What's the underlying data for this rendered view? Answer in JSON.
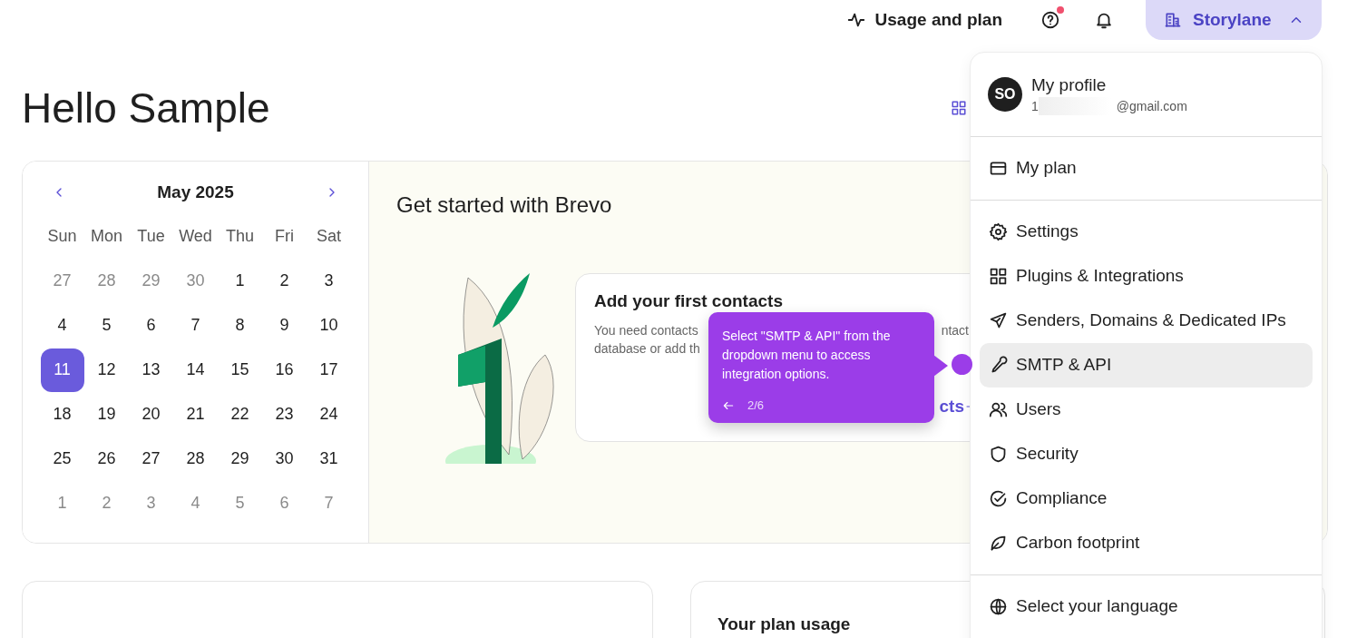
{
  "header": {
    "usage_link": "Usage and plan",
    "help_has_notification": true,
    "account_button": {
      "label": "Storylane",
      "expanded": true
    }
  },
  "greeting": "Hello Sample",
  "calendar": {
    "month": "May 2025",
    "weekdays": [
      "Sun",
      "Mon",
      "Tue",
      "Wed",
      "Thu",
      "Fri",
      "Sat"
    ],
    "weeks": [
      [
        {
          "day": "27",
          "outside": true,
          "selected": false
        },
        {
          "day": "28",
          "outside": true,
          "selected": false
        },
        {
          "day": "29",
          "outside": true,
          "selected": false
        },
        {
          "day": "30",
          "outside": true,
          "selected": false
        },
        {
          "day": "1",
          "outside": false,
          "selected": false
        },
        {
          "day": "2",
          "outside": false,
          "selected": false
        },
        {
          "day": "3",
          "outside": false,
          "selected": false
        }
      ],
      [
        {
          "day": "4",
          "outside": false,
          "selected": false
        },
        {
          "day": "5",
          "outside": false,
          "selected": false
        },
        {
          "day": "6",
          "outside": false,
          "selected": false
        },
        {
          "day": "7",
          "outside": false,
          "selected": false
        },
        {
          "day": "8",
          "outside": false,
          "selected": false
        },
        {
          "day": "9",
          "outside": false,
          "selected": false
        },
        {
          "day": "10",
          "outside": false,
          "selected": false
        }
      ],
      [
        {
          "day": "11",
          "outside": false,
          "selected": true
        },
        {
          "day": "12",
          "outside": false,
          "selected": false
        },
        {
          "day": "13",
          "outside": false,
          "selected": false
        },
        {
          "day": "14",
          "outside": false,
          "selected": false
        },
        {
          "day": "15",
          "outside": false,
          "selected": false
        },
        {
          "day": "16",
          "outside": false,
          "selected": false
        },
        {
          "day": "17",
          "outside": false,
          "selected": false
        }
      ],
      [
        {
          "day": "18",
          "outside": false,
          "selected": false
        },
        {
          "day": "19",
          "outside": false,
          "selected": false
        },
        {
          "day": "20",
          "outside": false,
          "selected": false
        },
        {
          "day": "21",
          "outside": false,
          "selected": false
        },
        {
          "day": "22",
          "outside": false,
          "selected": false
        },
        {
          "day": "23",
          "outside": false,
          "selected": false
        },
        {
          "day": "24",
          "outside": false,
          "selected": false
        }
      ],
      [
        {
          "day": "25",
          "outside": false,
          "selected": false
        },
        {
          "day": "26",
          "outside": false,
          "selected": false
        },
        {
          "day": "27",
          "outside": false,
          "selected": false
        },
        {
          "day": "28",
          "outside": false,
          "selected": false
        },
        {
          "day": "29",
          "outside": false,
          "selected": false
        },
        {
          "day": "30",
          "outside": false,
          "selected": false
        },
        {
          "day": "31",
          "outside": false,
          "selected": false
        }
      ],
      [
        {
          "day": "1",
          "outside": true,
          "selected": false
        },
        {
          "day": "2",
          "outside": true,
          "selected": false
        },
        {
          "day": "3",
          "outside": true,
          "selected": false
        },
        {
          "day": "4",
          "outside": true,
          "selected": false
        },
        {
          "day": "5",
          "outside": true,
          "selected": false
        },
        {
          "day": "6",
          "outside": true,
          "selected": false
        },
        {
          "day": "7",
          "outside": true,
          "selected": false
        }
      ]
    ]
  },
  "get_started": {
    "title": "Get started with Brevo",
    "card": {
      "title": "Add your first contacts",
      "line_1_start": "You need contacts",
      "line_1_end": "ntact",
      "line_2": "database or add th",
      "link": "cts"
    }
  },
  "plan_usage": {
    "title": "Your plan usage"
  },
  "account_menu": {
    "avatar": "SO",
    "name": "My profile",
    "email_start": "1",
    "email_end": "@gmail.com",
    "sections": [
      [
        {
          "label": "My plan",
          "highlighted": false
        }
      ],
      [
        {
          "label": "Settings",
          "highlighted": false
        },
        {
          "label": "Plugins & Integrations",
          "highlighted": false
        },
        {
          "label": "Senders, Domains & Dedicated IPs",
          "highlighted": false
        },
        {
          "label": "SMTP & API",
          "highlighted": true
        },
        {
          "label": "Users",
          "highlighted": false
        },
        {
          "label": "Security",
          "highlighted": false
        },
        {
          "label": "Compliance",
          "highlighted": false
        },
        {
          "label": "Carbon footprint",
          "highlighted": false
        }
      ],
      [
        {
          "label": "Select your language",
          "highlighted": false
        }
      ]
    ]
  },
  "tour_tooltip": {
    "text": "Select \"SMTP & API\" from the dropdown menu to access integration options.",
    "step": "2/6"
  }
}
